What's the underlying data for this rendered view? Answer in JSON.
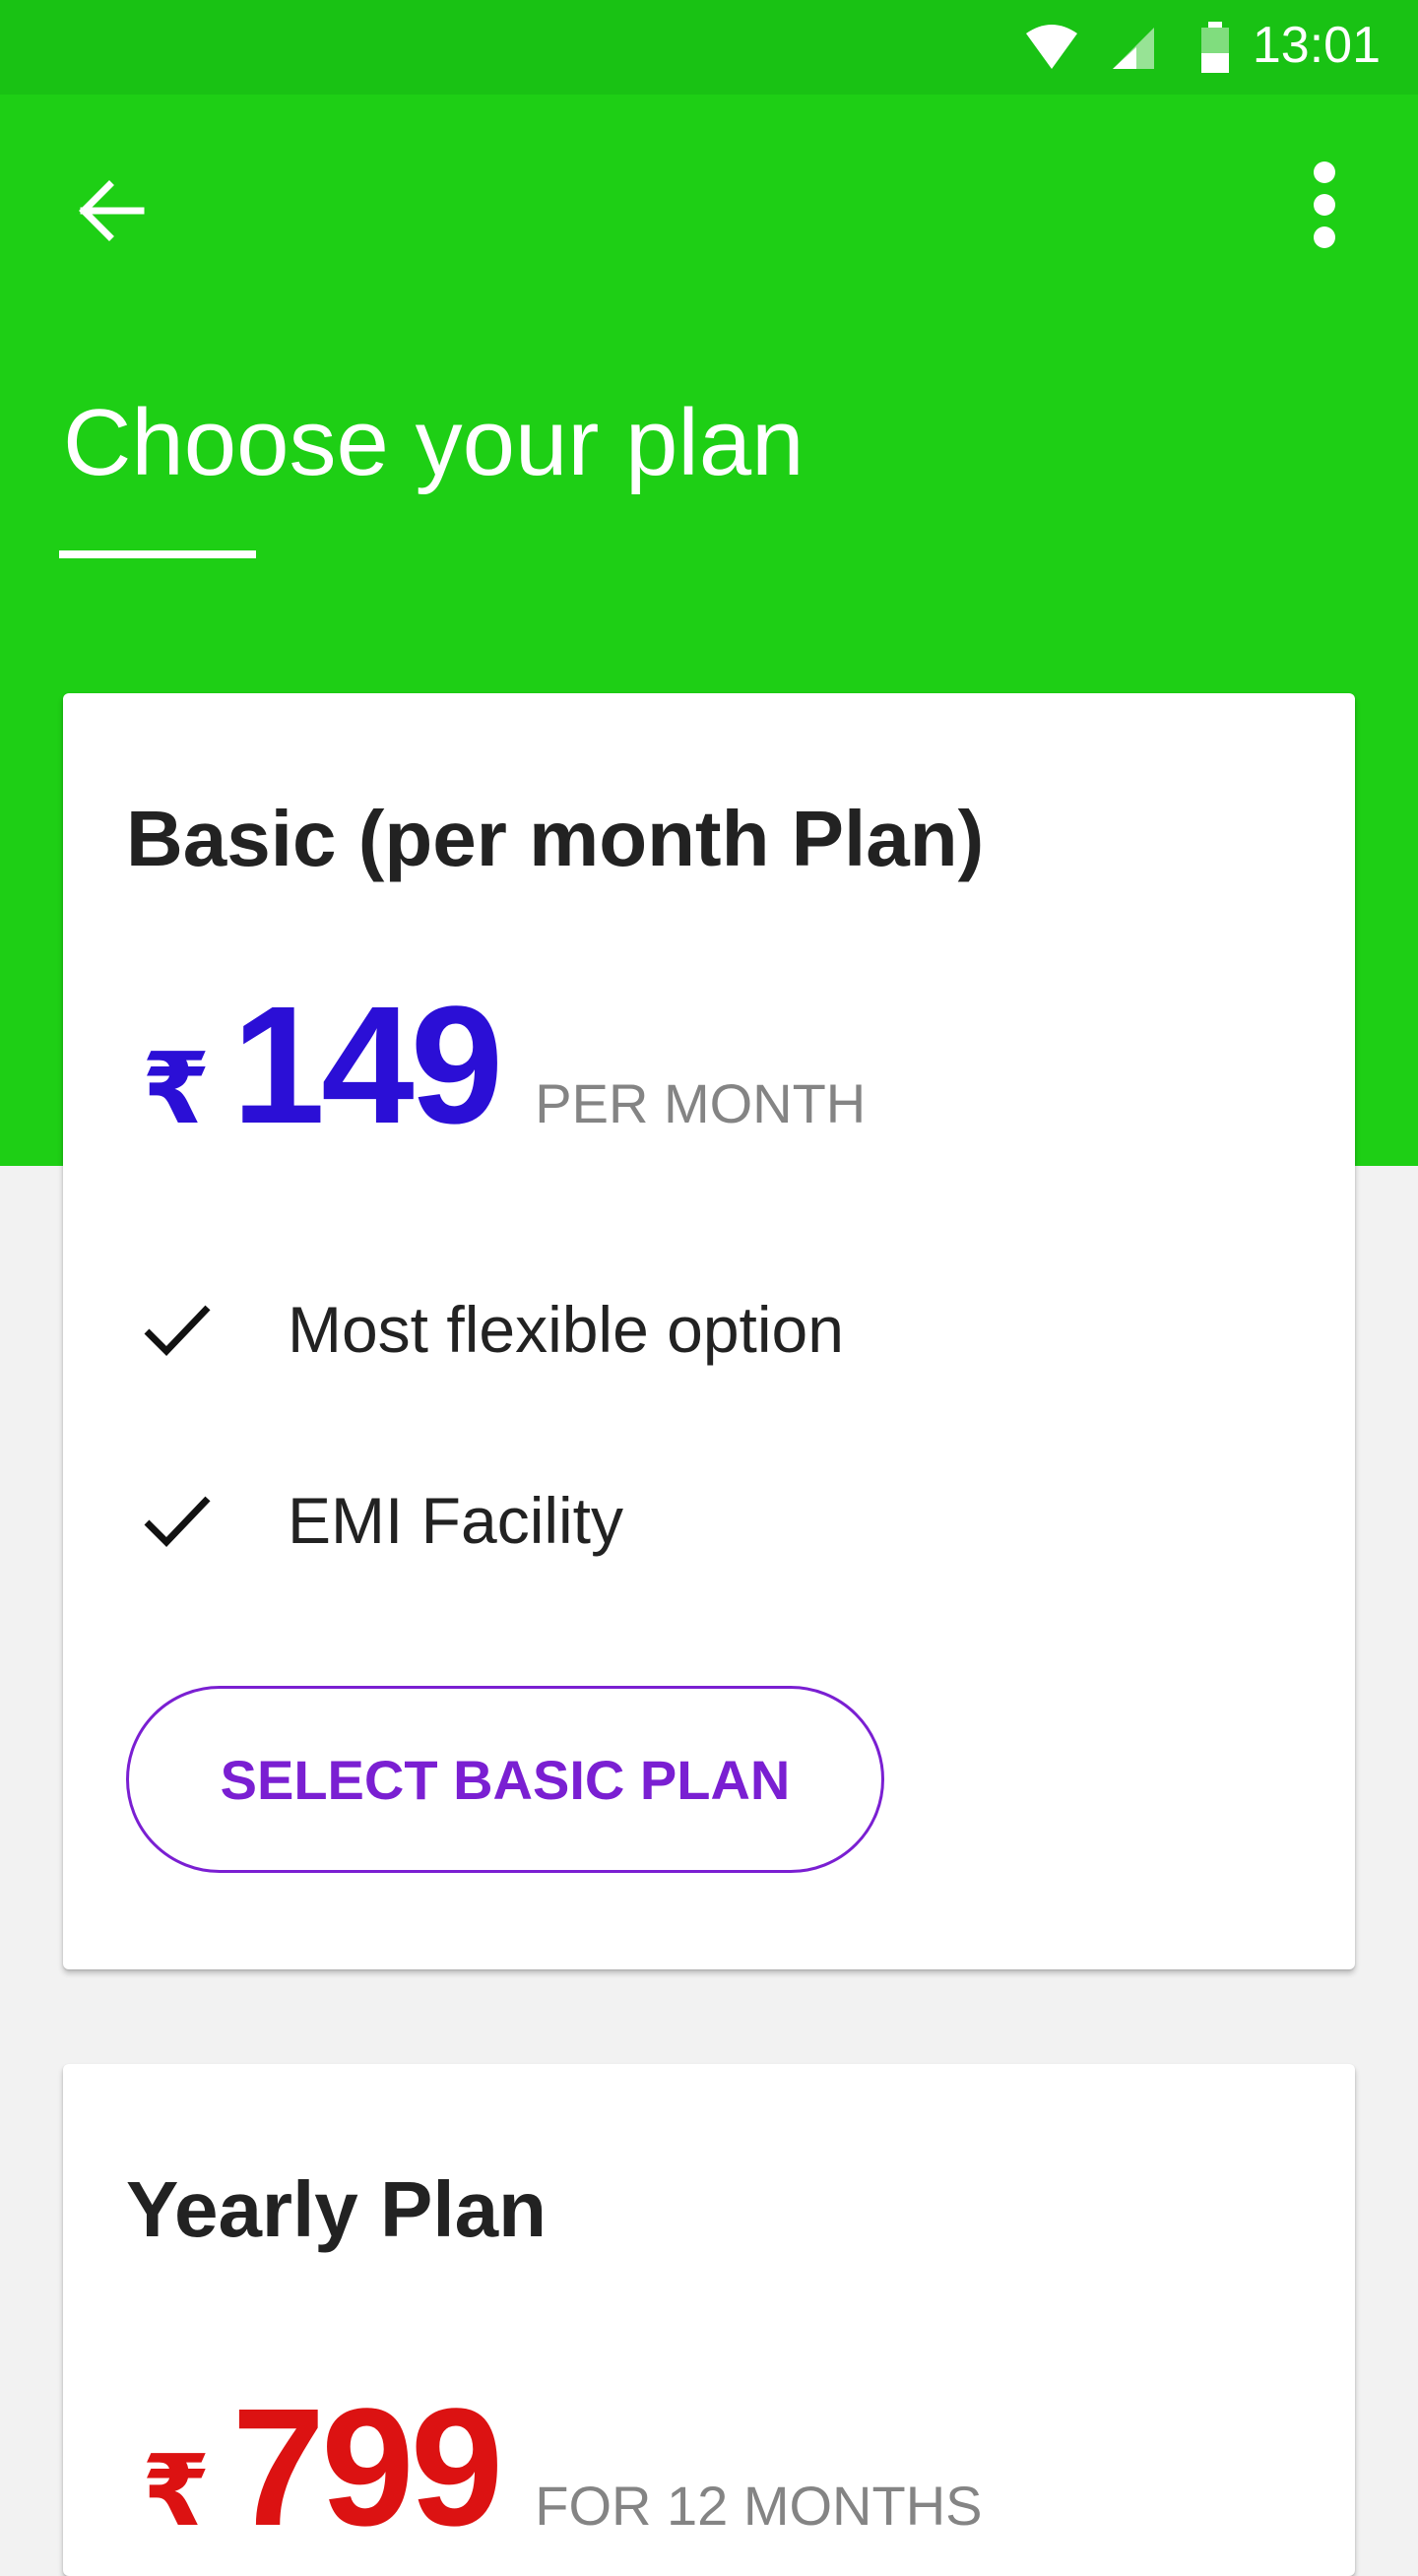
{
  "status_bar": {
    "time": "13:01",
    "icons": [
      "wifi-icon",
      "cell-signal-icon",
      "battery-icon"
    ]
  },
  "header": {
    "title": "Choose your plan",
    "back_icon": "arrow-left-icon",
    "menu_icon": "more-vertical-icon",
    "background_color": "#1ecf15"
  },
  "plans": [
    {
      "name": "Basic (per month Plan)",
      "currency": "₹",
      "price": "149",
      "period": "PER MONTH",
      "price_color": "#2b0fd6",
      "features": [
        "Most flexible option",
        "EMI Facility"
      ],
      "button_label": "SELECT BASIC PLAN",
      "button_color": "#7a1fd2"
    },
    {
      "name": "Yearly Plan",
      "currency": "₹",
      "price": "799",
      "period": "FOR 12 MONTHS",
      "price_color": "#dc1212"
    }
  ]
}
